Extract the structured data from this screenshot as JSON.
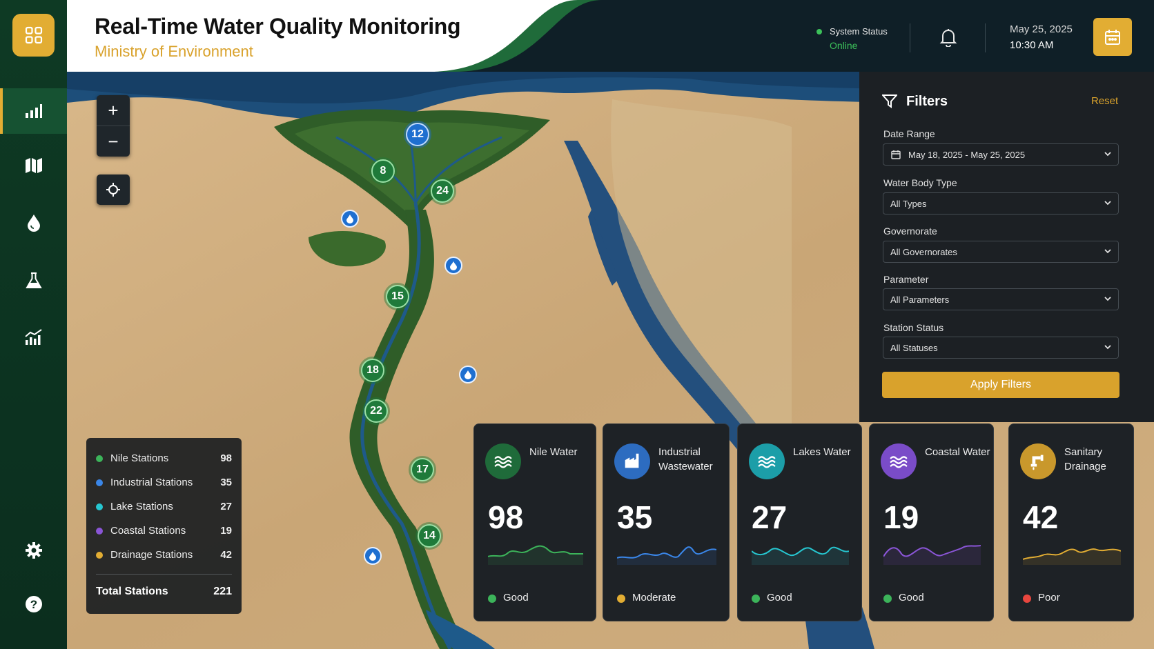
{
  "header": {
    "title": "Real-Time Water Quality Monitoring",
    "subtitle": "Ministry of Environment",
    "system_status_label": "System Status",
    "system_status_value": "Online",
    "date": "May 25, 2025",
    "time": "10:30 AM"
  },
  "sidebar": {
    "items": [
      {
        "icon": "bar-chart-icon",
        "active": true
      },
      {
        "icon": "map-icon",
        "active": false
      },
      {
        "icon": "water-drop-icon",
        "active": false
      },
      {
        "icon": "flask-icon",
        "active": false
      },
      {
        "icon": "analytics-icon",
        "active": false
      },
      {
        "icon": "gear-icon",
        "active": false
      },
      {
        "icon": "help-icon",
        "active": false
      }
    ]
  },
  "map": {
    "markers": [
      {
        "label": "12",
        "kind": "blue"
      },
      {
        "label": "8",
        "kind": "green"
      },
      {
        "label": "24",
        "kind": "green"
      },
      {
        "label": "15",
        "kind": "green"
      },
      {
        "label": "18",
        "kind": "green"
      },
      {
        "label": "22",
        "kind": "green"
      },
      {
        "label": "17",
        "kind": "green"
      },
      {
        "label": "14",
        "kind": "green"
      }
    ]
  },
  "legend": {
    "items": [
      {
        "name": "Nile Stations",
        "count": "98",
        "color": "#3cb45a"
      },
      {
        "name": "Industrial Stations",
        "count": "35",
        "color": "#3a86e8"
      },
      {
        "name": "Lake Stations",
        "count": "27",
        "color": "#26c6d0"
      },
      {
        "name": "Coastal Stations",
        "count": "19",
        "color": "#8a55d6"
      },
      {
        "name": "Drainage Stations",
        "count": "42",
        "color": "#e2ad33"
      }
    ],
    "total_label": "Total Stations",
    "total_value": "221"
  },
  "filters": {
    "title": "Filters",
    "reset": "Reset",
    "date_range_label": "Date Range",
    "date_range_value": "May 18, 2025 - May 25, 2025",
    "water_body_label": "Water Body Type",
    "water_body_value": "All Types",
    "governorate_label": "Governorate",
    "governorate_value": "All Governorates",
    "parameter_label": "Parameter",
    "parameter_value": "All Parameters",
    "station_status_label": "Station Status",
    "station_status_value": "All Statuses",
    "apply": "Apply Filters"
  },
  "cards": [
    {
      "name": "Nile Water",
      "value": "98",
      "status": "Good",
      "status_color": "#3cb45a",
      "icon_bg": "#1f6b3a",
      "spark_color": "#3cb45a",
      "icon": "waves-icon"
    },
    {
      "name": "Industrial Wastewater",
      "value": "35",
      "status": "Moderate",
      "status_color": "#e2ad33",
      "icon_bg": "#2d6cc0",
      "spark_color": "#3a86e8",
      "icon": "factory-icon"
    },
    {
      "name": "Lakes Water",
      "value": "27",
      "status": "Good",
      "status_color": "#3cb45a",
      "icon_bg": "#1c9ea8",
      "spark_color": "#26c6d0",
      "icon": "waves-icon"
    },
    {
      "name": "Coastal Water",
      "value": "19",
      "status": "Good",
      "status_color": "#3cb45a",
      "icon_bg": "#7a4cc8",
      "spark_color": "#8a55d6",
      "icon": "waves-icon"
    },
    {
      "name": "Sanitary Drainage",
      "value": "42",
      "status": "Poor",
      "status_color": "#e8463e",
      "icon_bg": "#c9982c",
      "spark_color": "#e2ad33",
      "icon": "pipe-icon"
    }
  ]
}
